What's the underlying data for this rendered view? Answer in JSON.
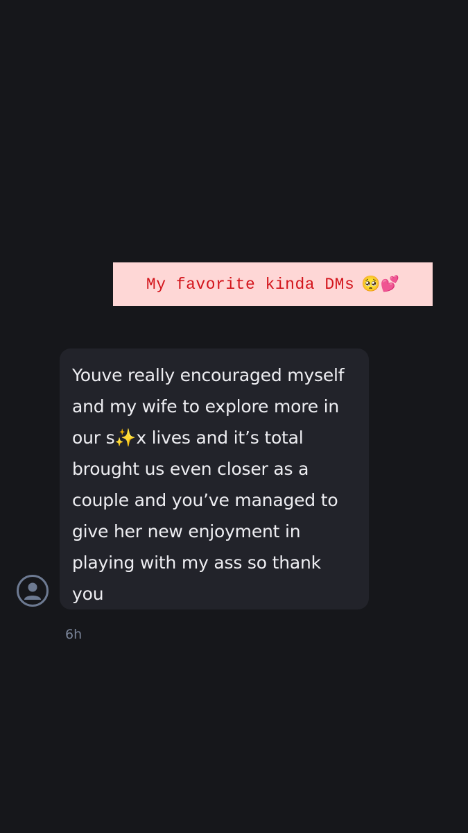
{
  "caption": {
    "text": "My favorite kinda DMs",
    "emoji": "🥺💕"
  },
  "message": {
    "text": "Youve really encouraged myself\nand my wife to explore more in\nour s✨x lives and it’s total\nbrought us even closer as a\ncouple and you’ve managed to\ngive her new enjoyment in\nplaying with my ass so thank\nyou",
    "timestamp": "6h"
  },
  "icons": {
    "avatar": "user-avatar-placeholder-icon"
  },
  "colors": {
    "background": "#16171b",
    "caption_background": "#fed7d6",
    "caption_text": "#d3141b",
    "bubble_background": "#22232a",
    "bubble_text": "#eeeef2",
    "timestamp": "#7a8498",
    "avatar_outline": "#6d7a92"
  }
}
